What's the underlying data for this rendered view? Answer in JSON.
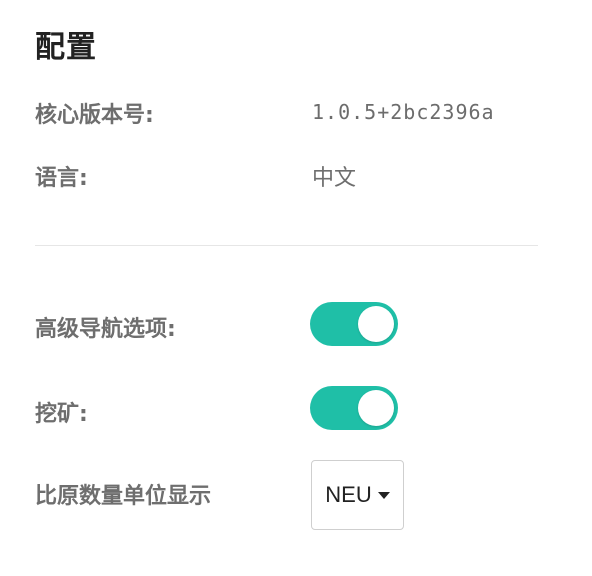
{
  "title": "配置",
  "info": {
    "core_version_label": "核心版本号:",
    "core_version_value": "1.0.5+2bc2396a",
    "language_label": "语言:",
    "language_value": "中文"
  },
  "settings": {
    "advanced_nav_label": "高级导航选项:",
    "advanced_nav_on": true,
    "mining_label": "挖矿:",
    "mining_on": true,
    "unit_display_label": "比原数量单位显示",
    "unit_display_value": "NEU"
  },
  "colors": {
    "toggle_on": "#1fbfa7",
    "toggle_off": "#cccccc"
  }
}
